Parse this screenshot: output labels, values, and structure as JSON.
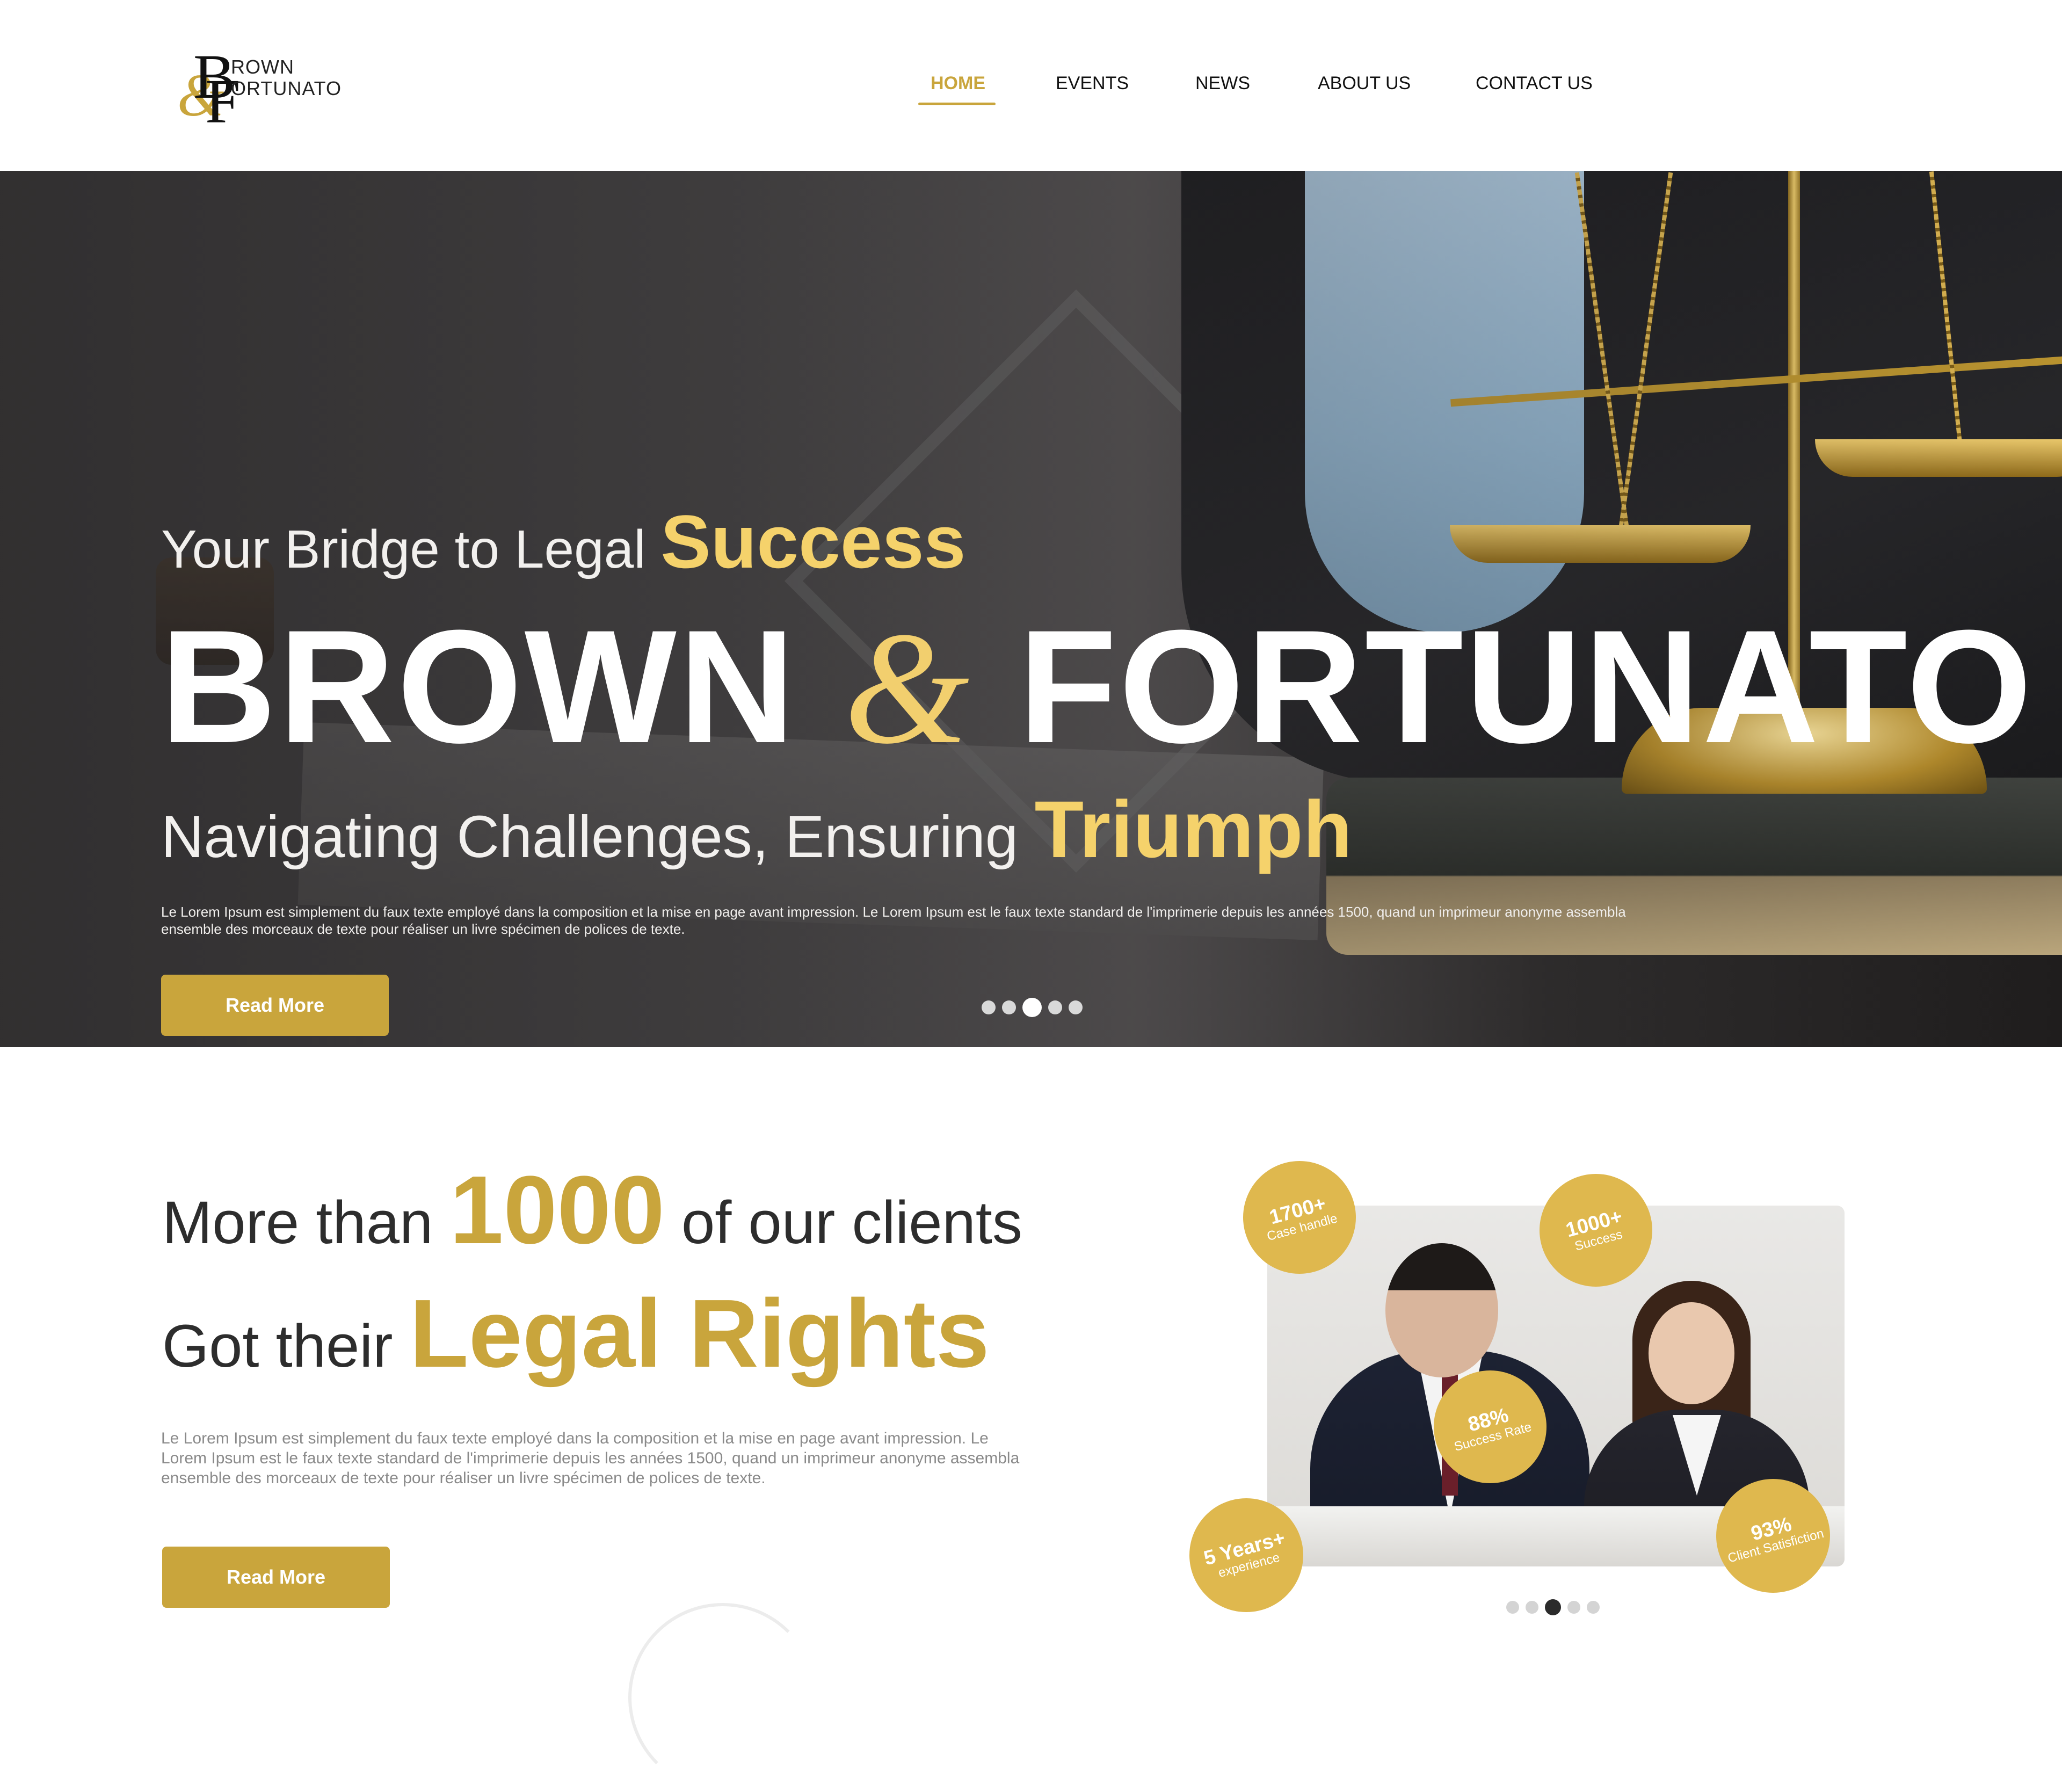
{
  "brand": {
    "logo_letter_b": "B",
    "logo_letter_f": "F",
    "logo_amp": "&",
    "logo_word1": "ROWN",
    "logo_word2": "ORTUNATO"
  },
  "nav": {
    "items": [
      {
        "label": "HOME",
        "active": true
      },
      {
        "label": "EVENTS"
      },
      {
        "label": "NEWS"
      },
      {
        "label": "ABOUT US"
      },
      {
        "label": "CONTACT US"
      }
    ]
  },
  "hero": {
    "line1_pre": "Your Bridge to Legal ",
    "line1_highlight": "Success",
    "title_part1": "BROWN ",
    "title_amp": "&",
    "title_part2": " FORTUNATO",
    "line3_pre": "Navigating Challenges, Ensuring ",
    "line3_highlight": "Triumph",
    "description": "Le Lorem Ipsum est simplement du faux texte employé dans la composition et la mise en page avant impression. Le Lorem Ipsum est le faux texte standard de l'imprimerie depuis les années 1500, quand un imprimeur anonyme assembla ensemble des morceaux de texte pour réaliser un livre spécimen de polices de texte.",
    "button_label": "Read More",
    "slides_total": 5,
    "slide_active": 3
  },
  "stats": {
    "line1_pre": "More than ",
    "line1_number": "1000",
    "line1_post": " of our clients",
    "line2_pre": "Got their ",
    "line2_highlight": "Legal Rights",
    "description": "Le Lorem Ipsum est simplement du faux texte employé dans la composition et la mise en page avant impression. Le Lorem Ipsum est le faux texte standard de l'imprimerie depuis les années 1500, quand un imprimeur anonyme assembla ensemble des morceaux de texte pour réaliser un livre spécimen de polices de texte.",
    "button_label": "Read More",
    "badges": [
      {
        "value": "1700+",
        "label": "Case handle"
      },
      {
        "value": "1000+",
        "label": "Success"
      },
      {
        "value": "88%",
        "label": "Success Rate"
      },
      {
        "value": "5 Years+",
        "label": "experience"
      },
      {
        "value": "93%",
        "label": "Client Satisfiction"
      }
    ],
    "slides_total": 5,
    "slide_active": 3
  },
  "colors": {
    "accent_gold": "#c9a53c",
    "highlight_gold": "#f5d26b",
    "badge_gold": "#dfb84e"
  }
}
